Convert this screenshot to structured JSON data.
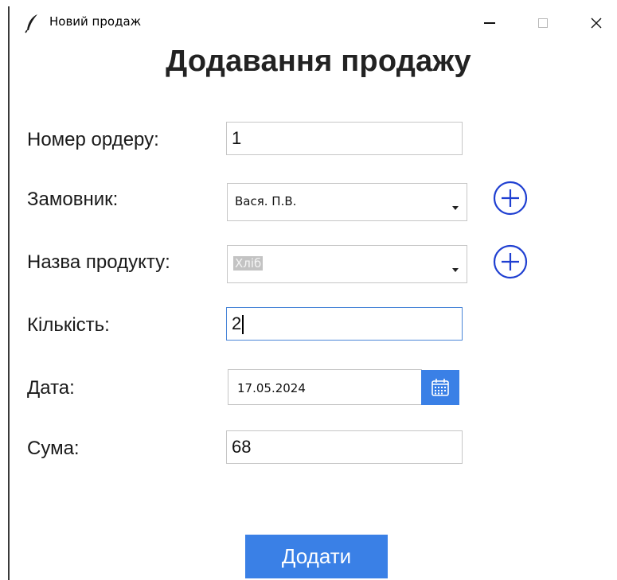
{
  "window": {
    "title": "Новий продаж",
    "minimize_glyph": "—",
    "close_glyph": "✕"
  },
  "heading": "Додавання продажу",
  "form": {
    "order_number": {
      "label": "Номер ордеру:",
      "value": "1"
    },
    "customer": {
      "label": "Замовник:",
      "value": "Вася. П.В."
    },
    "product_name": {
      "label": "Назва продукту:",
      "value": "Хліб"
    },
    "quantity": {
      "label": "Кількість:",
      "value": "2"
    },
    "date": {
      "label": "Дата:",
      "value": "17.05.2024"
    },
    "sum": {
      "label": "Сума:",
      "value": "68"
    }
  },
  "submit_label": "Додати",
  "icons": {
    "app": "feather-icon",
    "add_customer": "plus-circle-icon",
    "add_product": "plus-circle-icon",
    "calendar": "calendar-icon",
    "dropdown": "chevron-down-icon"
  },
  "colors": {
    "accent": "#3a80e6",
    "focus_border": "#4a86d8",
    "plus_icon": "#1f3fd1",
    "selection_bg": "#c3c3c3"
  }
}
